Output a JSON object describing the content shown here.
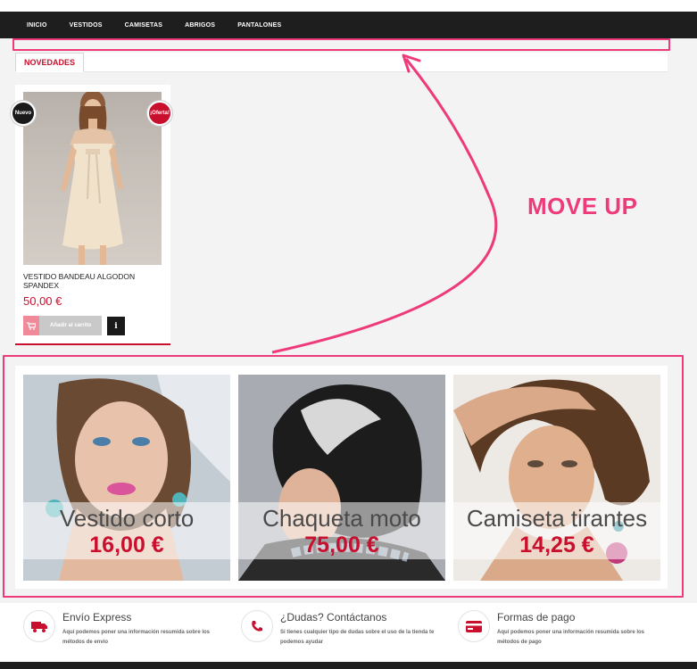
{
  "nav": {
    "items": [
      "INICIO",
      "VESTIDOS",
      "CAMISETAS",
      "ABRIGOS",
      "PANTALONES"
    ]
  },
  "tabs": {
    "active": "NOVEDADES"
  },
  "product": {
    "badge_new": "Nuevo",
    "badge_offer": "¡Oferta!",
    "title": "VESTIDO BANDEAU ALGODON SPANDEX",
    "price": "50,00 €",
    "add_to_cart": "Añadir al carrito",
    "info": "i"
  },
  "annotation": {
    "text": "MOVE UP",
    "color": "#ee3a7a"
  },
  "promos": [
    {
      "name": "Vestido corto",
      "price": "16,00 €"
    },
    {
      "name": "Chaqueta moto",
      "price": "75,00 €"
    },
    {
      "name": "Camiseta tirantes",
      "price": "14,25 €"
    }
  ],
  "features": [
    {
      "icon": "truck-icon",
      "title": "Envío Express",
      "desc": "Aquí podemos poner una información resumida sobre los métodos de envío"
    },
    {
      "icon": "phone-icon",
      "title": "¿Dudas? Contáctanos",
      "desc": "Si tienes cualquier tipo de dudas sobre el uso de la tienda te podemos ayudar"
    },
    {
      "icon": "credit-card-icon",
      "title": "Formas de pago",
      "desc": "Aquí podemos poner una información resumida sobre los métodos de pago"
    }
  ],
  "colors": {
    "accent": "#c8102e",
    "nav_bg": "#1e1e1e",
    "highlight": "#ee3a7a"
  }
}
